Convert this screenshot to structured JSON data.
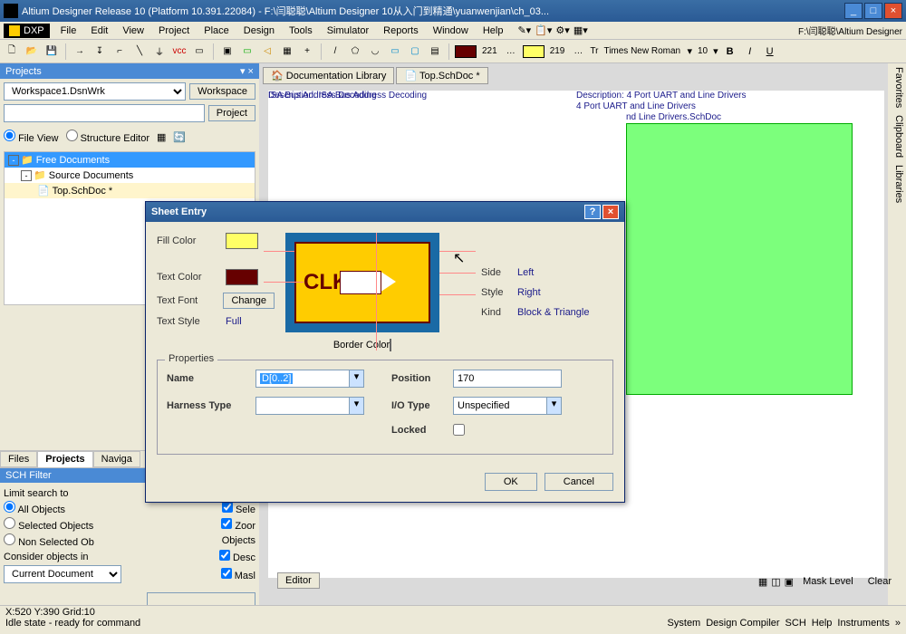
{
  "titlebar": {
    "text": "Altium Designer Release 10 (Platform 10.391.22084) - F:\\闫聪聪\\Altium Designer 10从入门到精通\\yuanwenjian\\ch_03..."
  },
  "menubar": {
    "dxp": "DXP",
    "items": [
      "File",
      "Edit",
      "View",
      "Project",
      "Place",
      "Design",
      "Tools",
      "Simulator",
      "Reports",
      "Window",
      "Help"
    ],
    "path": "F:\\闫聪聪\\Altium Designer"
  },
  "toolbar": {
    "color1_num": "221",
    "color2_num": "219",
    "font_name": "Times New Roman",
    "font_size": "10"
  },
  "projects": {
    "title": "Projects",
    "workspace": "Workspace1.DsnWrk",
    "workspace_btn": "Workspace",
    "project_btn": "Project",
    "fileview": "File View",
    "structure": "Structure Editor",
    "tree": {
      "root": "Free Documents",
      "sub": "Source Documents",
      "doc": "Top.SchDoc *"
    },
    "tabs": [
      "Files",
      "Projects",
      "Naviga"
    ]
  },
  "sch_filter": {
    "title": "SCH Filter",
    "limit": "Limit search to",
    "objects": "Objects",
    "r1": "All Objects",
    "c1": "Sele",
    "r2": "Selected Objects",
    "c2": "Zoor",
    "r3": "Non Selected Ob",
    "c3_label": "Objects",
    "consider": "Consider objects in",
    "c4": "Desc",
    "doc": "Current Document",
    "c5": "Masl"
  },
  "doc_tabs": [
    "Documentation Library",
    "Top.SchDoc *"
  ],
  "canvas_desc": {
    "d1a": "Description: ISA Bus Address Decoding",
    "d1b": "ISA Bus Address Decoding",
    "d2a": "Description: 4 Port UART and Line Drivers",
    "d2b": "4 Port UART and Line Drivers",
    "d2c": "nd Line Drivers.SchDoc"
  },
  "right_side": [
    "Favorites",
    "Clipboard",
    "Libraries"
  ],
  "editor_tab": "Editor",
  "bottom_btns": [
    "Mask Level",
    "Clear"
  ],
  "statusbar": {
    "coords": "X:520 Y:390  Grid:10",
    "idle": "Idle state - ready for command",
    "right": [
      "System",
      "Design Compiler",
      "SCH",
      "Help",
      "Instruments"
    ]
  },
  "dialog": {
    "title": "Sheet Entry",
    "fill_color_label": "Fill Color",
    "fill_color": "#ffff66",
    "text_color_label": "Text Color",
    "text_color": "#660000",
    "text_font_label": "Text Font",
    "change_btn": "Change",
    "text_style_label": "Text Style",
    "text_style_val": "Full",
    "border_color_label": "Border Color",
    "border_color": "#660000",
    "preview_text": "CLK",
    "side_label": "Side",
    "side_val": "Left",
    "style_label": "Style",
    "style_val": "Right",
    "kind_label": "Kind",
    "kind_val": "Block & Triangle",
    "props_title": "Properties",
    "name_label": "Name",
    "name_val": "D[0..2]",
    "position_label": "Position",
    "position_val": "170",
    "harness_label": "Harness Type",
    "harness_val": "",
    "iotype_label": "I/O Type",
    "iotype_val": "Unspecified",
    "locked_label": "Locked",
    "ok": "OK",
    "cancel": "Cancel"
  }
}
